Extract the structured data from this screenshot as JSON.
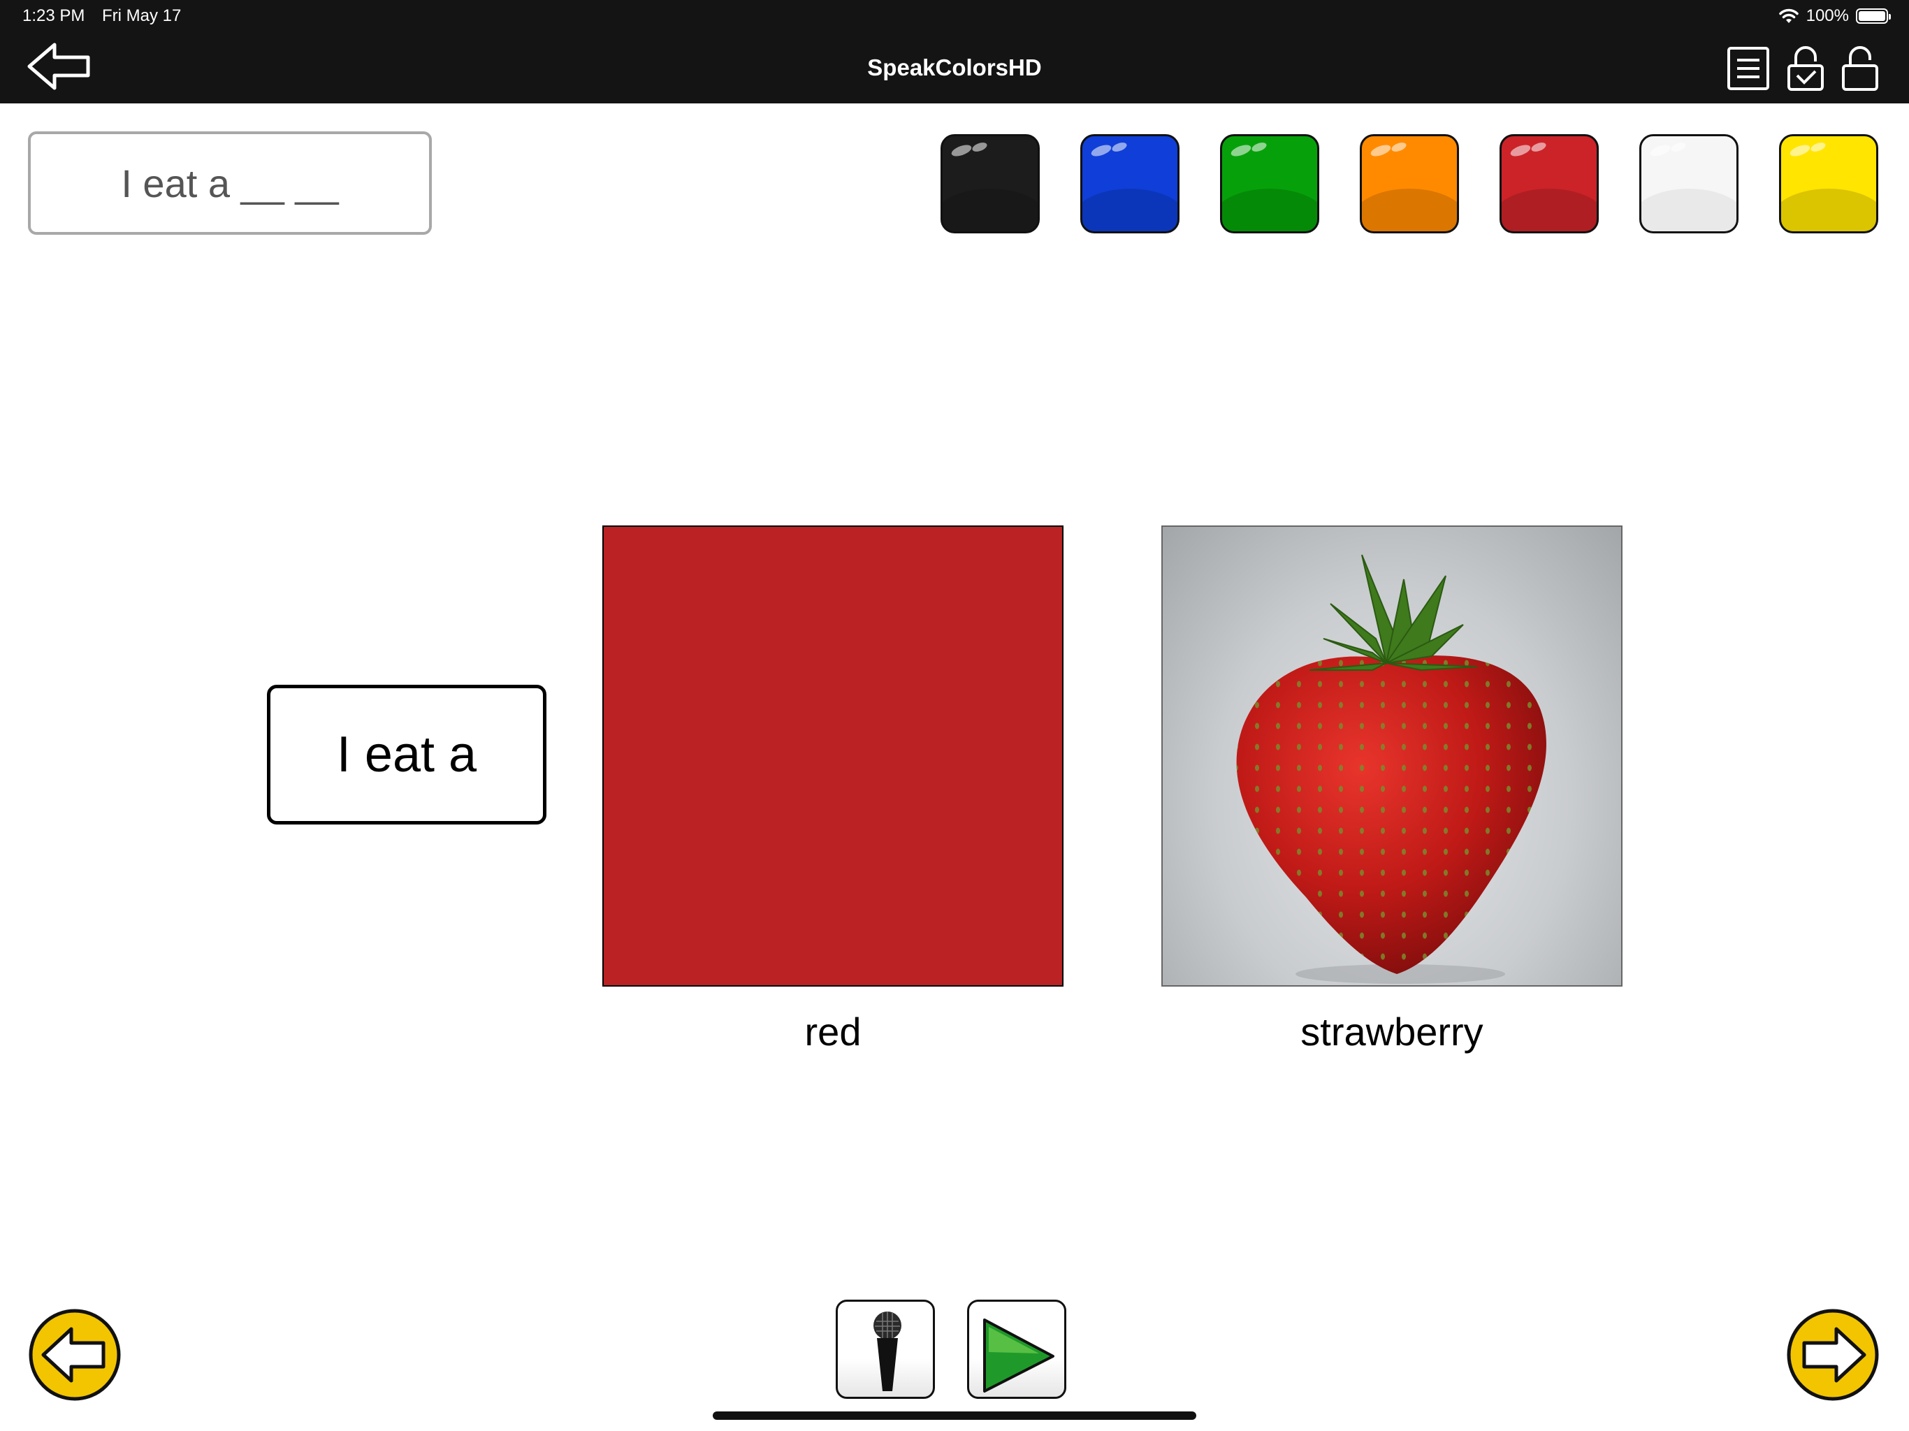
{
  "status_bar": {
    "time": "1:23 PM",
    "date": "Fri May 17",
    "battery": "100%"
  },
  "app": {
    "title": "SpeakColorsHD"
  },
  "sentence": {
    "text": "I eat a __ __"
  },
  "palette": {
    "swatches": [
      {
        "name": "black",
        "color": "#1c1c1c"
      },
      {
        "name": "blue",
        "color": "#0f3fd8"
      },
      {
        "name": "green",
        "color": "#06a10a"
      },
      {
        "name": "orange",
        "color": "#ff8a00"
      },
      {
        "name": "red",
        "color": "#cc2328"
      },
      {
        "name": "white",
        "color": "#f6f6f6"
      },
      {
        "name": "yellow",
        "color": "#ffe500"
      }
    ]
  },
  "main": {
    "phrase": "I eat a",
    "color_card": {
      "label": "red",
      "color": "#bb2223"
    },
    "fruit_card": {
      "label": "strawberry"
    }
  },
  "colors": {
    "topbar": "#141414",
    "nav_yellow": "#f2c500"
  },
  "icons": {
    "back": "arrow-left-outline-icon",
    "list": "list-icon",
    "lock_check": "lock-check-icon",
    "unlock": "unlock-icon",
    "prev": "arrow-left-circle-icon",
    "next": "arrow-right-circle-icon",
    "mic": "microphone-icon",
    "play": "play-icon"
  }
}
